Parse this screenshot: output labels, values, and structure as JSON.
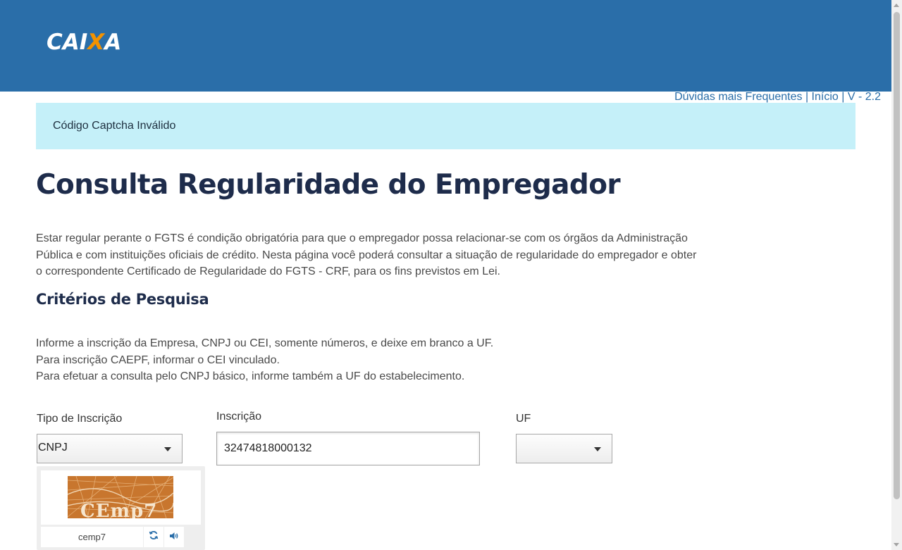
{
  "brand": {
    "logo_text_1": "CAI",
    "logo_text_x": "X",
    "logo_text_2": "A",
    "header_color": "#2a6ea9",
    "accent_color": "#f39200"
  },
  "top_links": {
    "faq": "Dúvidas mais Frequentes",
    "separator": "|",
    "home": "Início",
    "version": "V - 2.2"
  },
  "alert": {
    "message": "Código Captcha Inválido",
    "background": "#c5f0f9"
  },
  "page": {
    "title": "Consulta Regularidade do Empregador",
    "intro": "Estar regular perante o FGTS é condição obrigatória para que o empregador possa relacionar-se com os órgãos da Administração Pública e com instituições oficiais de crédito. Nesta página você poderá consultar a situação de regularidade do empregador e obter o correspondente Certificado de Regularidade do FGTS - CRF, para os fins previstos em Lei."
  },
  "criteria": {
    "title": "Critérios de Pesquisa",
    "lines": [
      "Informe a inscrição da Empresa, CNPJ ou CEI, somente números, e deixe em branco a UF.",
      "Para inscrição CAEPF, informar o CEI vinculado.",
      "Para efetuar a consulta pelo CNPJ básico, informe também a UF do estabelecimento."
    ]
  },
  "form": {
    "tipo_label": "Tipo de Inscrição",
    "tipo_value": "CNPJ",
    "inscricao_label": "Inscrição",
    "inscricao_value": "32474818000132",
    "uf_label": "UF",
    "uf_value": ""
  },
  "captcha": {
    "image_text": "CEmp7",
    "typed_value": "cemp7",
    "refresh_icon": "refresh-icon",
    "audio_icon": "speaker-icon"
  }
}
